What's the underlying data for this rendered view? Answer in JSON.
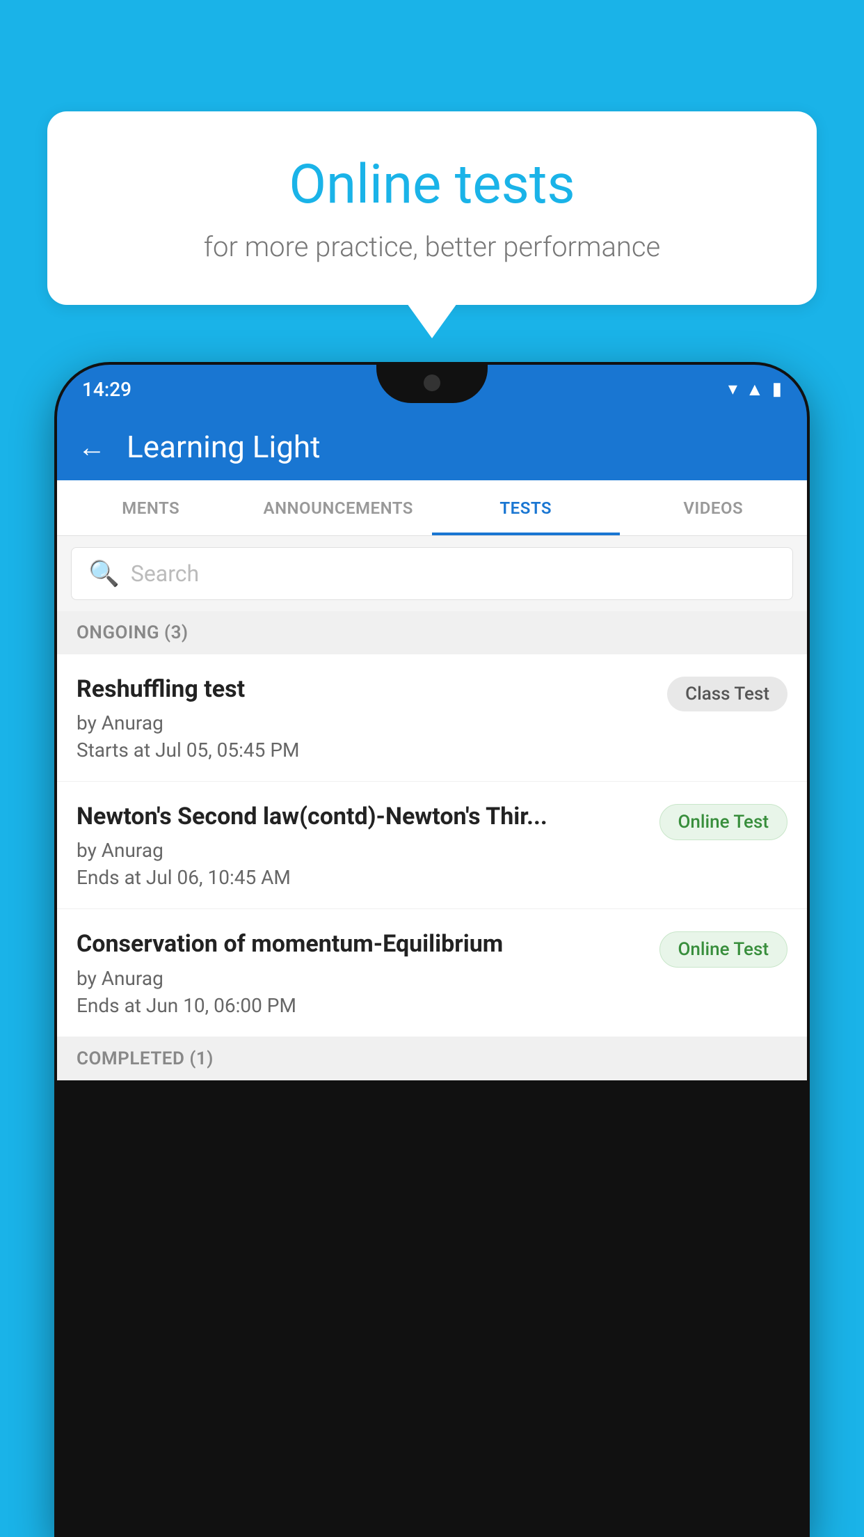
{
  "background_color": "#1ab3e8",
  "speech_bubble": {
    "title": "Online tests",
    "subtitle": "for more practice, better performance"
  },
  "phone": {
    "status_bar": {
      "time": "14:29",
      "wifi": "▾",
      "signal": "▴",
      "battery": "▮"
    },
    "app_header": {
      "back_label": "←",
      "title": "Learning Light"
    },
    "tabs": [
      {
        "label": "MENTS",
        "active": false
      },
      {
        "label": "ANNOUNCEMENTS",
        "active": false
      },
      {
        "label": "TESTS",
        "active": true
      },
      {
        "label": "VIDEOS",
        "active": false
      }
    ],
    "search": {
      "placeholder": "Search"
    },
    "ongoing_section": {
      "header": "ONGOING (3)",
      "items": [
        {
          "name": "Reshuffling test",
          "by": "by Anurag",
          "time": "Starts at  Jul 05, 05:45 PM",
          "badge": "Class Test",
          "badge_type": "class"
        },
        {
          "name": "Newton's Second law(contd)-Newton's Thir...",
          "by": "by Anurag",
          "time": "Ends at  Jul 06, 10:45 AM",
          "badge": "Online Test",
          "badge_type": "online"
        },
        {
          "name": "Conservation of momentum-Equilibrium",
          "by": "by Anurag",
          "time": "Ends at  Jun 10, 06:00 PM",
          "badge": "Online Test",
          "badge_type": "online"
        }
      ]
    },
    "completed_section": {
      "header": "COMPLETED (1)"
    }
  }
}
